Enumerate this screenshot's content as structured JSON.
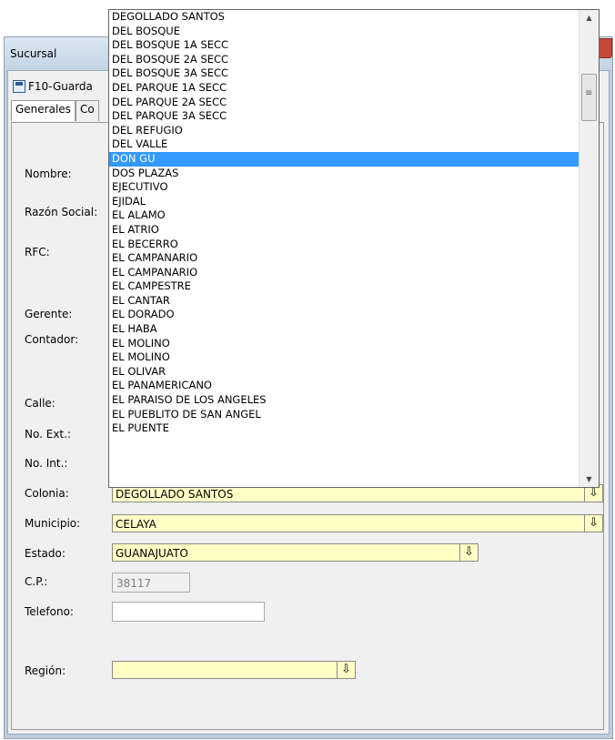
{
  "window": {
    "title": "Sucursal"
  },
  "toolbar": {
    "save_label": "F10-Guarda"
  },
  "tabs": [
    "Generales",
    "Co"
  ],
  "labels": {
    "nombre": "Nombre:",
    "razon_social": "Razón Social:",
    "rfc": "RFC:",
    "gerente": "Gerente:",
    "contador": "Contador:",
    "calle": "Calle:",
    "no_ext": "No. Ext.:",
    "no_int": "No. Int.:",
    "colonia": "Colonia:",
    "municipio": "Municipio:",
    "estado": "Estado:",
    "cp": "C.P.:",
    "telefono": "Telefono:",
    "region": "Región:"
  },
  "fields": {
    "colonia": "DEGOLLADO SANTOS",
    "municipio": "CELAYA",
    "estado": "GUANAJUATO",
    "cp": "38117",
    "telefono": "",
    "region": ""
  },
  "dropdown": {
    "selected_index": 10,
    "items": [
      "DEGOLLADO SANTOS",
      "DEL BOSQUE",
      "DEL BOSQUE  1A SECC",
      "DEL BOSQUE  2A SECC",
      "DEL BOSQUE  3A SECC",
      "DEL PARQUE  1A SECC",
      "DEL PARQUE  2A SECC",
      "DEL PARQUE  3A SECC",
      "DEL REFUGIO",
      "DEL VALLE",
      "DON GU",
      "DOS PLAZAS",
      "EJECUTIVO",
      "EJIDAL",
      "EL ALAMO",
      "EL ATRIO",
      "EL BECERRO",
      "EL CAMPANARIO",
      "EL CAMPANARIO",
      "EL CAMPESTRE",
      "EL CANTAR",
      "EL DORADO",
      "EL HABA",
      "EL MOLINO",
      "EL MOLINO",
      "EL OLIVAR",
      "EL PANAMERICANO",
      "EL PARAISO DE LOS ANGELES",
      "EL PUEBLITO DE SAN ANGEL",
      "EL PUENTE"
    ]
  },
  "icons": {
    "dropdown_arrow": "⇩",
    "save": "save-icon"
  },
  "colors": {
    "selection": "#3399ff",
    "field_bg": "#ffffc6"
  }
}
